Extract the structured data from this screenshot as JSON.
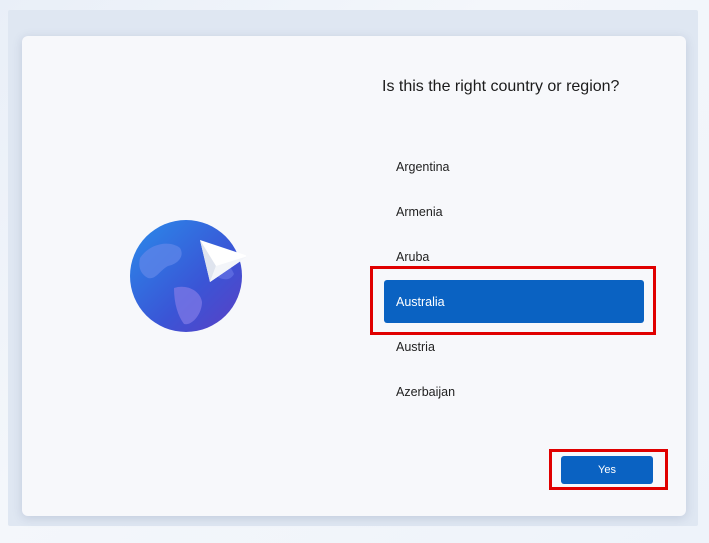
{
  "dialog": {
    "title": "Is this the right country or region?",
    "countries": [
      {
        "label": "Argentina",
        "selected": false
      },
      {
        "label": "Armenia",
        "selected": false
      },
      {
        "label": "Aruba",
        "selected": false
      },
      {
        "label": "Australia",
        "selected": true
      },
      {
        "label": "Austria",
        "selected": false
      },
      {
        "label": "Azerbaijan",
        "selected": false
      }
    ],
    "yes_label": "Yes"
  },
  "icons": {
    "illustration": "globe-paper-plane-icon"
  },
  "colors": {
    "accent": "#0a62c2",
    "highlight": "#e00000",
    "globe_blue": "#2d6fd6"
  }
}
